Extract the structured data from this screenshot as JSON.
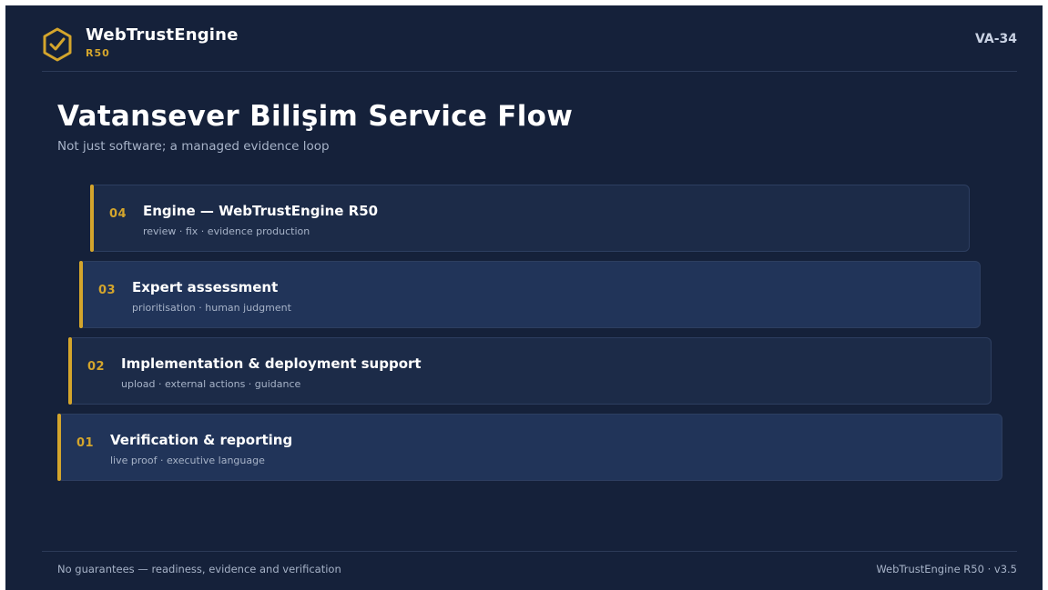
{
  "header": {
    "brand_name": "WebTrustEngine",
    "brand_sub": "R50",
    "slide_id": "VA-34",
    "logo_icon": "shield-check-icon"
  },
  "title": "Vatansever Bilişim Service Flow",
  "subtitle": "Not just software; a managed evidence loop",
  "steps": [
    {
      "num": "04",
      "name": "Engine — WebTrustEngine R50",
      "desc": "review · fix · evidence production"
    },
    {
      "num": "03",
      "name": "Expert assessment",
      "desc": "prioritisation · human judgment"
    },
    {
      "num": "02",
      "name": "Implementation & deployment support",
      "desc": "upload · external actions · guidance"
    },
    {
      "num": "01",
      "name": "Verification & reporting",
      "desc": "live proof · executive language"
    }
  ],
  "footer": {
    "left": "No guarantees — readiness, evidence and verification",
    "right": "WebTrustEngine R50 · v3.5"
  },
  "colors": {
    "background": "#15213a",
    "accent": "#d4a52c",
    "card": "#1c2b48",
    "card_alt": "#213459"
  }
}
